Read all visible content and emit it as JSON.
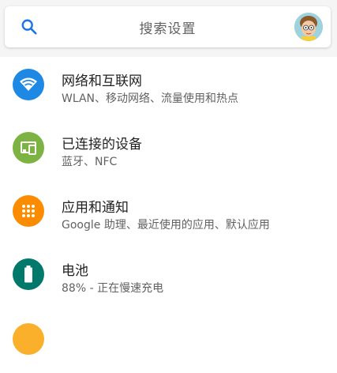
{
  "search": {
    "placeholder": "搜索设置"
  },
  "items": [
    {
      "title": "网络和互联网",
      "subtitle": "WLAN、移动网络、流量使用和热点",
      "icon": "wifi-icon",
      "color": "#1e88e5"
    },
    {
      "title": "已连接的设备",
      "subtitle": "蓝牙、NFC",
      "icon": "devices-icon",
      "color": "#7cb342"
    },
    {
      "title": "应用和通知",
      "subtitle": "Google 助理、最近使用的应用、默认应用",
      "icon": "apps-icon",
      "color": "#fb8c00"
    },
    {
      "title": "电池",
      "subtitle": "88% - 正在慢速充电",
      "icon": "battery-icon",
      "color": "#00796b"
    }
  ]
}
